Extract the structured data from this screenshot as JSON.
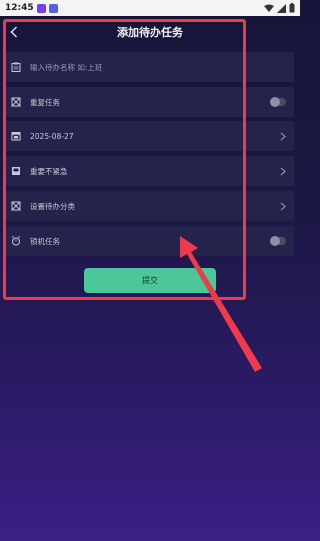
{
  "status_bar": {
    "time": "12:45"
  },
  "header": {
    "title": "添加待办任务"
  },
  "form": {
    "rows": [
      {
        "kind": "input",
        "icon": "clipboard-icon",
        "placeholder": "输入待办名称 如:上班",
        "value": ""
      },
      {
        "kind": "toggle",
        "icon": "repeat-icon",
        "label": "重复任务",
        "toggle_on": false
      },
      {
        "kind": "select",
        "icon": "calendar-icon",
        "label": "2025-08-27"
      },
      {
        "kind": "select",
        "icon": "flag-icon",
        "label": "重要不紧急"
      },
      {
        "kind": "select",
        "icon": "category-icon",
        "label": "设置待办分类"
      },
      {
        "kind": "toggle",
        "icon": "alarm-icon",
        "label": "锁机任务",
        "toggle_on": false
      }
    ],
    "submit_label": "提交"
  },
  "colors": {
    "accent": "#4cc79a",
    "row_bg": "#24234c",
    "annotation": "#ef3a4a"
  }
}
